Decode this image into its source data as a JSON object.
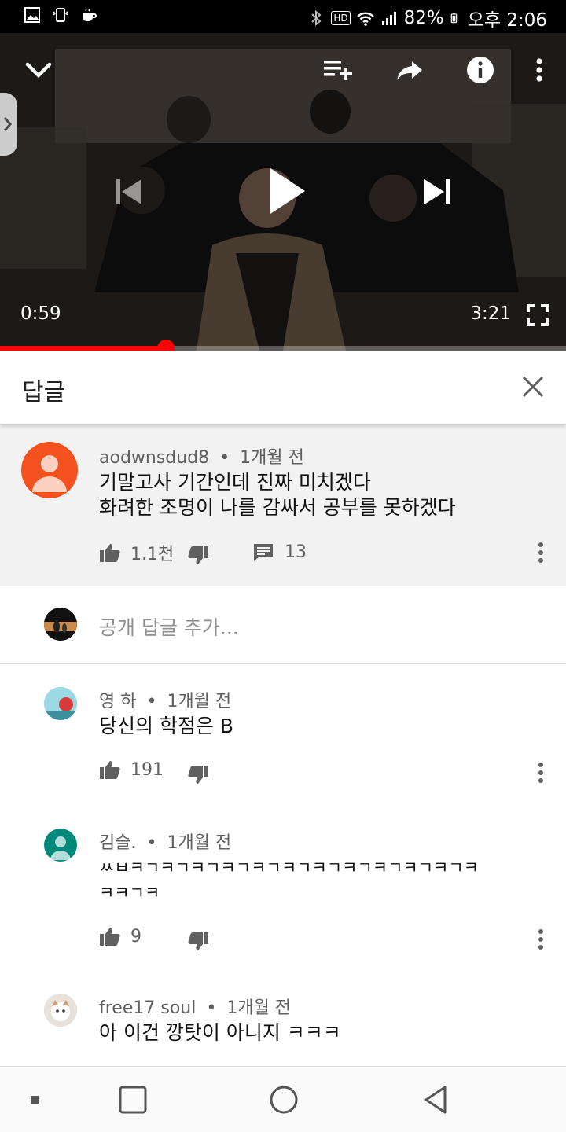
{
  "status_bar": {
    "battery": "82%",
    "time": "오후 2:06",
    "hd_badge": "HD",
    "icons": [
      "gallery-icon",
      "vibrate-icon",
      "cup-icon",
      "bluetooth-icon",
      "wifi-icon",
      "signal-icon",
      "battery-icon"
    ]
  },
  "player": {
    "current_time": "0:59",
    "duration": "3:21",
    "progress": 0.293,
    "accent": "#ff0000",
    "icons": [
      "chevron-down-icon",
      "add-to-playlist-icon",
      "share-icon",
      "info-icon",
      "more-vert-icon",
      "skip-previous-icon",
      "play-icon",
      "skip-next-icon",
      "fullscreen-icon"
    ]
  },
  "replies_panel": {
    "title": "답글"
  },
  "main_comment": {
    "author": "aodwnsdud8",
    "separator": "•",
    "age": "1개월 전",
    "line1": "기말고사 기간인데 진짜 미치겠다",
    "line2": "화려한 조명이 나를 감싸서 공부를 못하겠다",
    "likes": "1.1천",
    "reply_count": "13",
    "avatar_color": "#f4511e"
  },
  "add_reply": {
    "placeholder": "공개 답글 추가..."
  },
  "replies": [
    {
      "author": "영 하",
      "separator": "•",
      "age": "1개월 전",
      "text": "당신의 학점은 B",
      "likes": "191"
    },
    {
      "author": "김슬.",
      "separator": "•",
      "age": "1개월 전",
      "line1": "ㅆㅂㅋㄱㅋㄱㅋㄱㅋㄱㅋㄱㅋㄱㅋㄱㅋㄱㅋㄱㅋㄱㅋㄱㅋ",
      "line2": "ㅋㅋㄱㅋ",
      "likes": "9",
      "avatar_color": "#00897b"
    },
    {
      "author": "free17 soul",
      "separator": "•",
      "age": "1개월 전",
      "text": "아 이건 깡탓이 아니지 ㅋㅋㅋ"
    }
  ],
  "nav": {
    "icons": [
      "recent-dot-icon",
      "recents-square-icon",
      "home-circle-icon",
      "back-triangle-icon"
    ]
  }
}
